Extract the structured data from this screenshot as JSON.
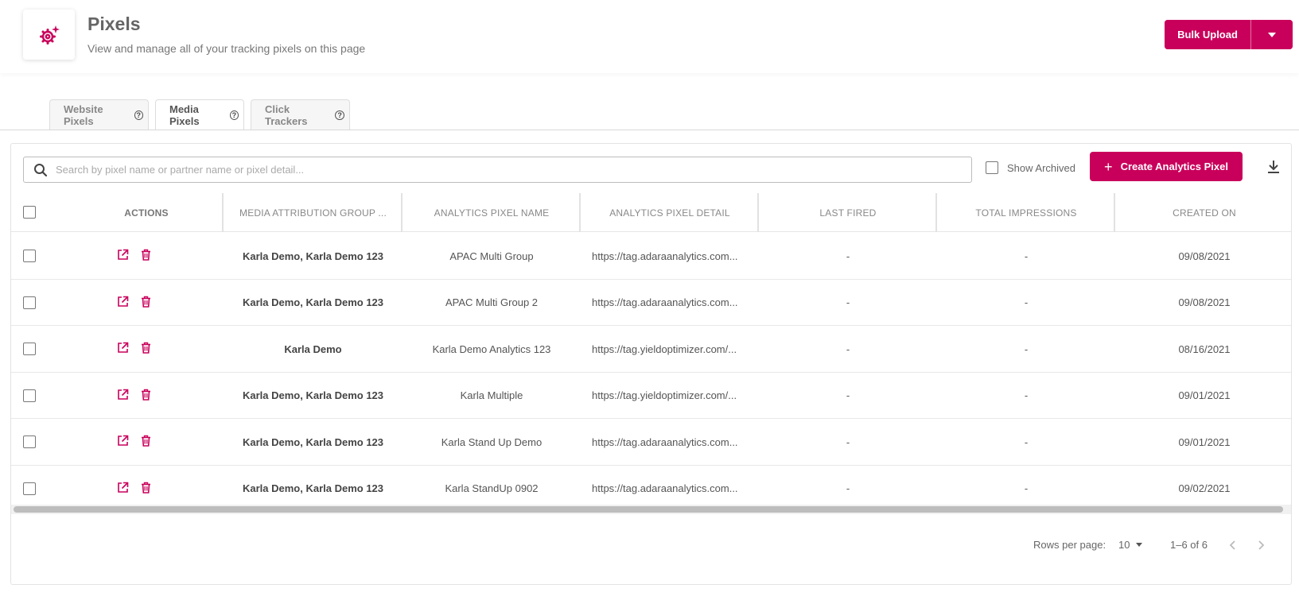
{
  "header": {
    "title": "Pixels",
    "subtitle": "View and manage all of your tracking pixels on this page",
    "icon": "gear-sparkle-icon",
    "bulk_upload_label": "Bulk Upload"
  },
  "tabs": [
    {
      "label": "Website Pixels",
      "active": false
    },
    {
      "label": "Media Pixels",
      "active": true
    },
    {
      "label": "Click Trackers",
      "active": false
    }
  ],
  "tab_help_glyph": "?",
  "toolbar": {
    "search_placeholder": "Search by pixel name or partner name or pixel detail...",
    "show_archived_label": "Show Archived",
    "create_label": "Create Analytics Pixel",
    "create_plus": "+"
  },
  "table": {
    "headers": {
      "actions": "ACTIONS",
      "group": "MEDIA ATTRIBUTION GROUP ...",
      "name": "ANALYTICS PIXEL NAME",
      "detail": "ANALYTICS PIXEL DETAIL",
      "last_fired": "LAST FIRED",
      "impressions": "TOTAL IMPRESSIONS",
      "created": "CREATED ON"
    },
    "rows": [
      {
        "group": "Karla Demo, Karla Demo 123",
        "name": "APAC Multi Group",
        "detail": "https://tag.adaraanalytics.com...",
        "last_fired": "-",
        "impressions": "-",
        "created": "09/08/2021"
      },
      {
        "group": "Karla Demo, Karla Demo 123",
        "name": "APAC Multi Group 2",
        "detail": "https://tag.adaraanalytics.com...",
        "last_fired": "-",
        "impressions": "-",
        "created": "09/08/2021"
      },
      {
        "group": "Karla Demo",
        "name": "Karla Demo Analytics 123",
        "detail": "https://tag.yieldoptimizer.com/...",
        "last_fired": "-",
        "impressions": "-",
        "created": "08/16/2021"
      },
      {
        "group": "Karla Demo, Karla Demo 123",
        "name": "Karla Multiple",
        "detail": "https://tag.yieldoptimizer.com/...",
        "last_fired": "-",
        "impressions": "-",
        "created": "09/01/2021"
      },
      {
        "group": "Karla Demo, Karla Demo 123",
        "name": "Karla Stand Up Demo",
        "detail": "https://tag.adaraanalytics.com...",
        "last_fired": "-",
        "impressions": "-",
        "created": "09/01/2021"
      },
      {
        "group": "Karla Demo, Karla Demo 123",
        "name": "Karla StandUp 0902",
        "detail": "https://tag.adaraanalytics.com...",
        "last_fired": "-",
        "impressions": "-",
        "created": "09/02/2021"
      }
    ]
  },
  "pagination": {
    "rows_per_page_label": "Rows per page:",
    "rows_per_page_value": "10",
    "range_text": "1–6 of 6"
  },
  "colors": {
    "accent": "#c9005b",
    "text": "#555555",
    "border": "#e3e3e3"
  }
}
